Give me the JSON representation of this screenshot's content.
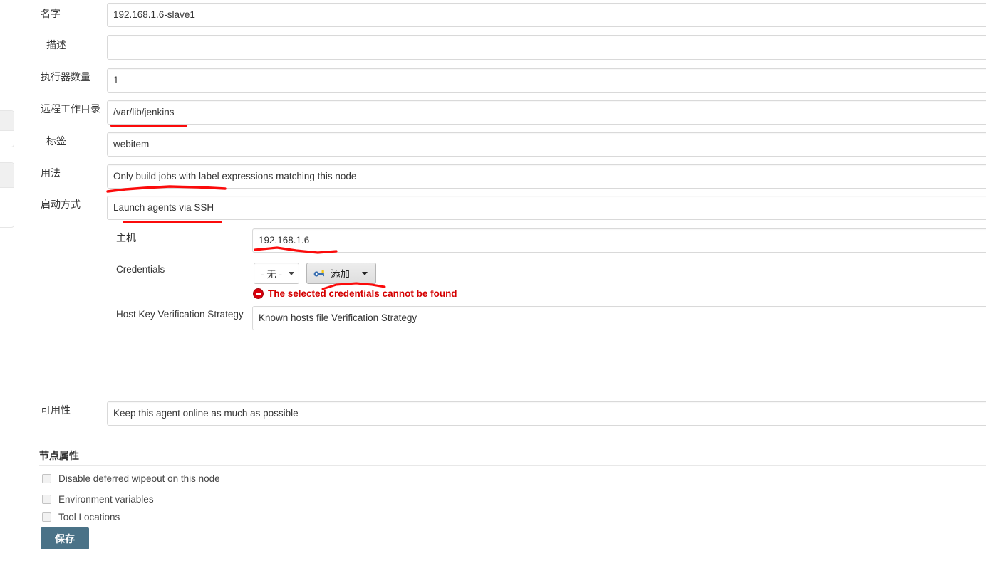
{
  "form": {
    "fields": [
      {
        "label": "名字",
        "value": "192.168.1.6-slave1",
        "type": "text"
      },
      {
        "label": "描述",
        "value": "",
        "type": "text"
      },
      {
        "label": "执行器数量",
        "value": "1",
        "type": "text"
      },
      {
        "label": "远程工作目录",
        "value": "/var/lib/jenkins",
        "type": "text"
      },
      {
        "label": "标签",
        "value": "webitem",
        "type": "text"
      },
      {
        "label": "用法",
        "value": "Only build jobs with label expressions matching this node",
        "type": "select"
      },
      {
        "label": "启动方式",
        "value": "Launch agents via SSH",
        "type": "select"
      }
    ],
    "ssh": {
      "host_label": "主机",
      "host_value": "192.168.1.6",
      "credentials_label": "Credentials",
      "credentials_value": "- 无 -",
      "add_button_label": "添加",
      "add_button_icon": "key-icon",
      "error_icon": "error-circle-icon",
      "error_message": "The selected credentials cannot be found",
      "host_key_label": "Host Key Verification Strategy",
      "host_key_value": "Known hosts file Verification Strategy"
    },
    "availability": {
      "label": "可用性",
      "value": "Keep this agent online as much as possible"
    }
  },
  "node_properties": {
    "title": "节点属性",
    "checkboxes": [
      {
        "label": "Disable deferred wipeout on this node",
        "checked": false
      },
      {
        "label": "Environment variables",
        "checked": false
      },
      {
        "label": "Tool Locations",
        "checked": false
      }
    ]
  },
  "actions": {
    "save_label": "保存"
  },
  "colors": {
    "save_button": "#4a7287",
    "error_text": "#d40000",
    "annotation": "#fb0b0b",
    "field_border": "#d9d9d9"
  }
}
